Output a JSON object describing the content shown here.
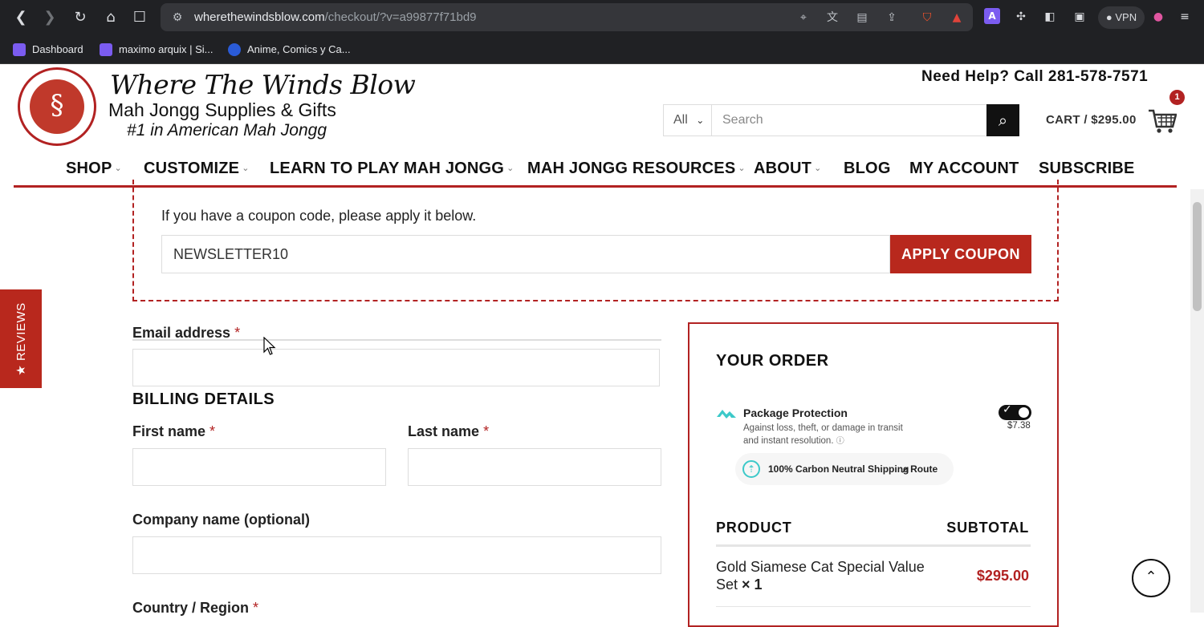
{
  "browser": {
    "url_domain": "wherethewindsblow.com",
    "url_path": "/checkout/?v=a99877f71bd9",
    "vpn_label": "VPN",
    "bookmarks": [
      {
        "label": "Dashboard",
        "color": "#7b5cf0"
      },
      {
        "label": "maximo arquix | Si...",
        "color": "#7b5cf0"
      },
      {
        "label": "Anime, Comics y Ca...",
        "color": "#2a5bd7"
      }
    ]
  },
  "header": {
    "logo_title": "Where The Winds Blow",
    "logo_sub1": "Mah Jongg Supplies & Gifts",
    "logo_sub2": "#1 in American Mah Jongg",
    "help_line": "Need Help? Call 281-578-7571",
    "search": {
      "category": "All",
      "placeholder": "Search"
    },
    "cart": {
      "label": "CART / $295.00",
      "count": "1"
    },
    "nav": [
      {
        "label": "SHOP",
        "caret": true
      },
      {
        "label": "CUSTOMIZE",
        "caret": true
      },
      {
        "label": "LEARN TO PLAY MAH JONGG",
        "caret": true
      },
      {
        "label": "MAH JONGG RESOURCES",
        "caret": true
      },
      {
        "label": "ABOUT",
        "caret": true
      },
      {
        "label": "BLOG",
        "caret": false
      },
      {
        "label": "MY ACCOUNT",
        "caret": false
      },
      {
        "label": "SUBSCRIBE",
        "caret": false
      }
    ]
  },
  "coupon": {
    "prompt": "If you have a coupon code, please apply it below.",
    "value": "NEWSLETTER10",
    "button": "APPLY COUPON"
  },
  "reviews_tab": "★ REVIEWS",
  "form": {
    "email_label": "Email address",
    "billing_heading": "BILLING DETAILS",
    "first_name_label": "First name",
    "last_name_label": "Last name",
    "company_label": "Company name (optional)",
    "country_label": "Country / Region",
    "required_mark": "*"
  },
  "order": {
    "heading": "YOUR ORDER",
    "protection": {
      "title": "Package Protection",
      "description": "Against loss, theft, or damage in transit and instant resolution.",
      "price": "$7.38",
      "enabled": true,
      "carbon_text": "100% Carbon Neutral Shipping",
      "brand": "Route",
      "accent": "#3cc9c9"
    },
    "col_product": "PRODUCT",
    "col_subtotal": "SUBTOTAL",
    "items": [
      {
        "name": "Gold Siamese Cat Special Value Set",
        "qty": "× 1",
        "price": "$295.00"
      }
    ]
  },
  "colors": {
    "brand_red": "#b22222",
    "button_red": "#b8281d"
  }
}
